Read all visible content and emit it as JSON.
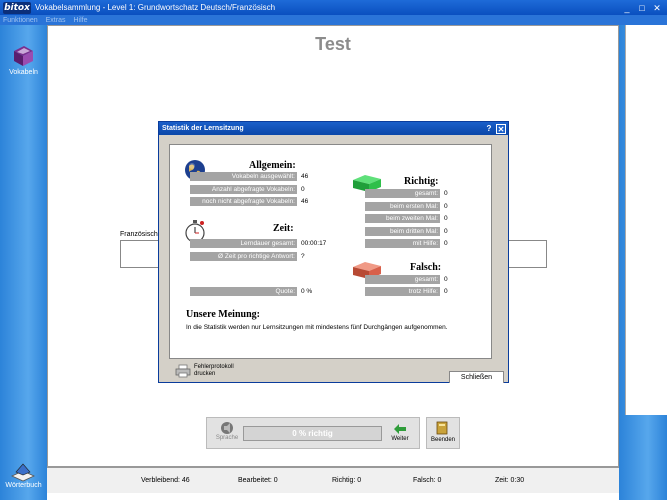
{
  "window": {
    "logo": "bitox",
    "title": "Vokabelsammlung - Level 1: Grundwortschatz Deutsch/Französisch",
    "minimize": "_",
    "maximize": "□",
    "close": "✕"
  },
  "menu": [
    "Funktionen",
    "Extras",
    "Hilfe"
  ],
  "sidebar": {
    "top_label": "Vokabeln",
    "bottom_label": "Wörterbuch"
  },
  "page": {
    "title": "Test",
    "field_label": "Französisch",
    "field_value": ""
  },
  "controls": {
    "sprache_label": "Sprache",
    "progress_text": "0 % richtig",
    "progress_percent": 0,
    "weiter_label": "Weiter",
    "beenden_label": "Beenden"
  },
  "status": {
    "verbleibend": "Verbleibend: 46",
    "bearbeitet": "Bearbeitet: 0",
    "richtig": "Richtig: 0",
    "falsch": "Falsch: 0",
    "zeit": "Zeit: 0:30"
  },
  "dialog": {
    "title": "Statistik der Lernsitzung",
    "help": "?",
    "close": "✕",
    "allgemein": {
      "heading": "Allgemein:",
      "rows": [
        {
          "label": "Vokabeln ausgewählt:",
          "value": "46"
        },
        {
          "label": "Anzahl abgefragte Vokabeln:",
          "value": "0"
        },
        {
          "label": "noch nicht abgefragte Vokabeln:",
          "value": "46"
        }
      ]
    },
    "zeit": {
      "heading": "Zeit:",
      "rows": [
        {
          "label": "Lerndauer gesamt:",
          "value": "00:00:17"
        },
        {
          "label": "Ø  Zeit pro richtige Antwort:",
          "value": "?"
        }
      ]
    },
    "quote": {
      "label": "Quote:",
      "value": "0 %"
    },
    "richtig": {
      "heading": "Richtig:",
      "rows": [
        {
          "label": "gesamt:",
          "value": "0"
        },
        {
          "label": "beim ersten Mal:",
          "value": "0"
        },
        {
          "label": "beim zweiten Mal:",
          "value": "0"
        },
        {
          "label": "beim dritten Mal:",
          "value": "0"
        },
        {
          "label": "mit Hilfe:",
          "value": "0"
        }
      ]
    },
    "falsch": {
      "heading": "Falsch:",
      "rows": [
        {
          "label": "gesamt:",
          "value": "0"
        },
        {
          "label": "trotz Hilfe:",
          "value": "0"
        }
      ]
    },
    "meinung": {
      "heading": "Unsere Meinung:",
      "text": "In die Statistik werden nur Lernsitzungen mit mindestens fünf Durchgängen aufgenommen."
    },
    "fehlerprotokoll": "Fehlerprotokoll\ndrucken",
    "schliessen": "Schließen"
  },
  "colors": {
    "titlebar": "#0a4fbf",
    "frame": "#2c83d9",
    "label_bg": "#a4a4a4",
    "richtig_icon": "#2fbf4a",
    "falsch_icon": "#d8604a"
  }
}
